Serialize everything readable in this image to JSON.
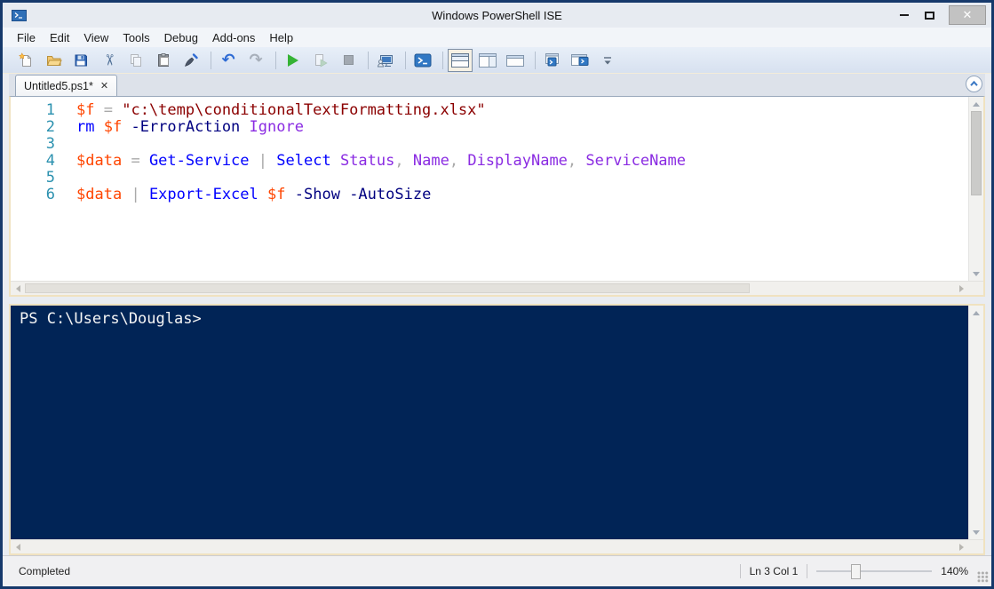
{
  "window": {
    "title": "Windows PowerShell ISE",
    "close_glyph": "✕"
  },
  "menu": {
    "items": [
      "File",
      "Edit",
      "View",
      "Tools",
      "Debug",
      "Add-ons",
      "Help"
    ]
  },
  "toolbar": {
    "buttons": [
      "new-script",
      "open-script",
      "save",
      "cut",
      "copy",
      "paste",
      "clear-console-pane",
      "undo",
      "redo",
      "run-script",
      "run-selection",
      "stop-operation",
      "new-remote-powershell-tab",
      "start-powershell-exe",
      "show-script-pane-top",
      "show-script-pane-right",
      "show-script-pane-maximized",
      "show-command-window",
      "show-command-add-on",
      "toolbar-overflow"
    ],
    "selected": "show-script-pane-top",
    "undo_glyph": "↶",
    "redo_glyph": "↷",
    "cut_glyph": "✂"
  },
  "tab": {
    "label": "Untitled5.ps1*",
    "close_glyph": "✕"
  },
  "editor": {
    "lines": [
      {
        "num": "1",
        "tokens": [
          {
            "c": "variable",
            "t": "$f"
          },
          {
            "c": "plain",
            "t": " "
          },
          {
            "c": "operator",
            "t": "="
          },
          {
            "c": "plain",
            "t": " "
          },
          {
            "c": "string",
            "t": "\"c:\\temp\\conditionalTextFormatting.xlsx\""
          }
        ]
      },
      {
        "num": "2",
        "tokens": [
          {
            "c": "command",
            "t": "rm"
          },
          {
            "c": "plain",
            "t": " "
          },
          {
            "c": "variable",
            "t": "$f"
          },
          {
            "c": "plain",
            "t": " "
          },
          {
            "c": "parameter",
            "t": "-ErrorAction"
          },
          {
            "c": "plain",
            "t": " "
          },
          {
            "c": "argument",
            "t": "Ignore"
          }
        ]
      },
      {
        "num": "3",
        "tokens": []
      },
      {
        "num": "4",
        "tokens": [
          {
            "c": "variable",
            "t": "$data"
          },
          {
            "c": "plain",
            "t": " "
          },
          {
            "c": "operator",
            "t": "="
          },
          {
            "c": "plain",
            "t": " "
          },
          {
            "c": "command",
            "t": "Get-Service"
          },
          {
            "c": "plain",
            "t": " "
          },
          {
            "c": "operator",
            "t": "|"
          },
          {
            "c": "plain",
            "t": " "
          },
          {
            "c": "command",
            "t": "Select"
          },
          {
            "c": "plain",
            "t": " "
          },
          {
            "c": "argument",
            "t": "Status"
          },
          {
            "c": "operator",
            "t": ","
          },
          {
            "c": "plain",
            "t": " "
          },
          {
            "c": "argument",
            "t": "Name"
          },
          {
            "c": "operator",
            "t": ","
          },
          {
            "c": "plain",
            "t": " "
          },
          {
            "c": "argument",
            "t": "DisplayName"
          },
          {
            "c": "operator",
            "t": ","
          },
          {
            "c": "plain",
            "t": " "
          },
          {
            "c": "argument",
            "t": "ServiceName"
          }
        ]
      },
      {
        "num": "5",
        "tokens": []
      },
      {
        "num": "6",
        "tokens": [
          {
            "c": "variable",
            "t": "$data"
          },
          {
            "c": "plain",
            "t": " "
          },
          {
            "c": "operator",
            "t": "|"
          },
          {
            "c": "plain",
            "t": " "
          },
          {
            "c": "command",
            "t": "Export-Excel"
          },
          {
            "c": "plain",
            "t": " "
          },
          {
            "c": "variable",
            "t": "$f"
          },
          {
            "c": "plain",
            "t": " "
          },
          {
            "c": "parameter",
            "t": "-Show"
          },
          {
            "c": "plain",
            "t": " "
          },
          {
            "c": "parameter",
            "t": "-AutoSize"
          }
        ]
      }
    ]
  },
  "console": {
    "prompt": "PS C:\\Users\\Douglas>"
  },
  "statusbar": {
    "status": "Completed",
    "position": "Ln 3 Col 1",
    "zoom_level": "140%"
  },
  "colors": {
    "console_bg": "#012456",
    "console_fg": "#F5F5F5",
    "line_number": "#2B91AF",
    "variable": "#FF4500",
    "string": "#8B0000",
    "command": "#0000FF",
    "parameter": "#000080",
    "argument": "#8A2BE2",
    "operator": "#A9A9A9",
    "plain": "#000000",
    "window_border": "#16396B"
  }
}
